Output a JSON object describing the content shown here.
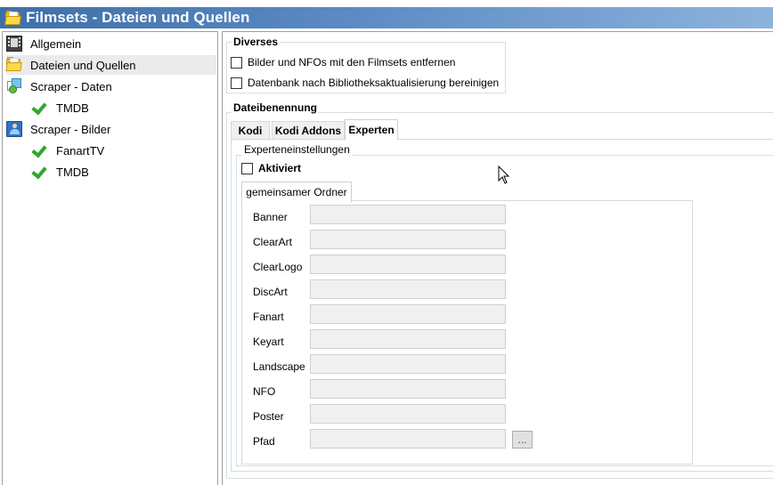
{
  "window": {
    "title": "Filmsets - Dateien und Quellen"
  },
  "sidebar": {
    "items": [
      {
        "label": "Allgemein",
        "icon": "film-icon"
      },
      {
        "label": "Dateien und Quellen",
        "icon": "folder-icon",
        "selected": true
      },
      {
        "label": "Scraper - Daten",
        "icon": "scraper-data-icon"
      },
      {
        "label": "TMDB",
        "icon": "checkmark-icon"
      },
      {
        "label": "Scraper - Bilder",
        "icon": "image-icon"
      },
      {
        "label": "FanartTV",
        "icon": "checkmark-icon"
      },
      {
        "label": "TMDB",
        "icon": "checkmark-icon"
      }
    ]
  },
  "diverses": {
    "title": "Diverses",
    "option1": "Bilder und NFOs mit den Filmsets entfernen",
    "option2": "Datenbank nach Bibliotheksaktualisierung bereinigen"
  },
  "dateibenennung": {
    "title": "Dateibenennung",
    "tabs": [
      "Kodi",
      "Kodi Addons",
      "Experten"
    ],
    "active_tab": "Experten"
  },
  "experten": {
    "group_title": "Experteneinstellungen",
    "enabled_label": "Aktiviert",
    "subtab": "gemeinsamer Ordner",
    "fields": [
      {
        "label": "Banner",
        "value": ""
      },
      {
        "label": "ClearArt",
        "value": ""
      },
      {
        "label": "ClearLogo",
        "value": ""
      },
      {
        "label": "DiscArt",
        "value": ""
      },
      {
        "label": "Fanart",
        "value": ""
      },
      {
        "label": "Keyart",
        "value": ""
      },
      {
        "label": "Landscape",
        "value": ""
      },
      {
        "label": "NFO",
        "value": ""
      },
      {
        "label": "Poster",
        "value": ""
      },
      {
        "label": "Pfad",
        "value": ""
      }
    ],
    "browse_label": "..."
  },
  "colors": {
    "titlebar_start": "#3e6fa8",
    "titlebar_end": "#8db3dd",
    "check_green": "#2fa82a",
    "selected_bg": "#ebebeb"
  }
}
